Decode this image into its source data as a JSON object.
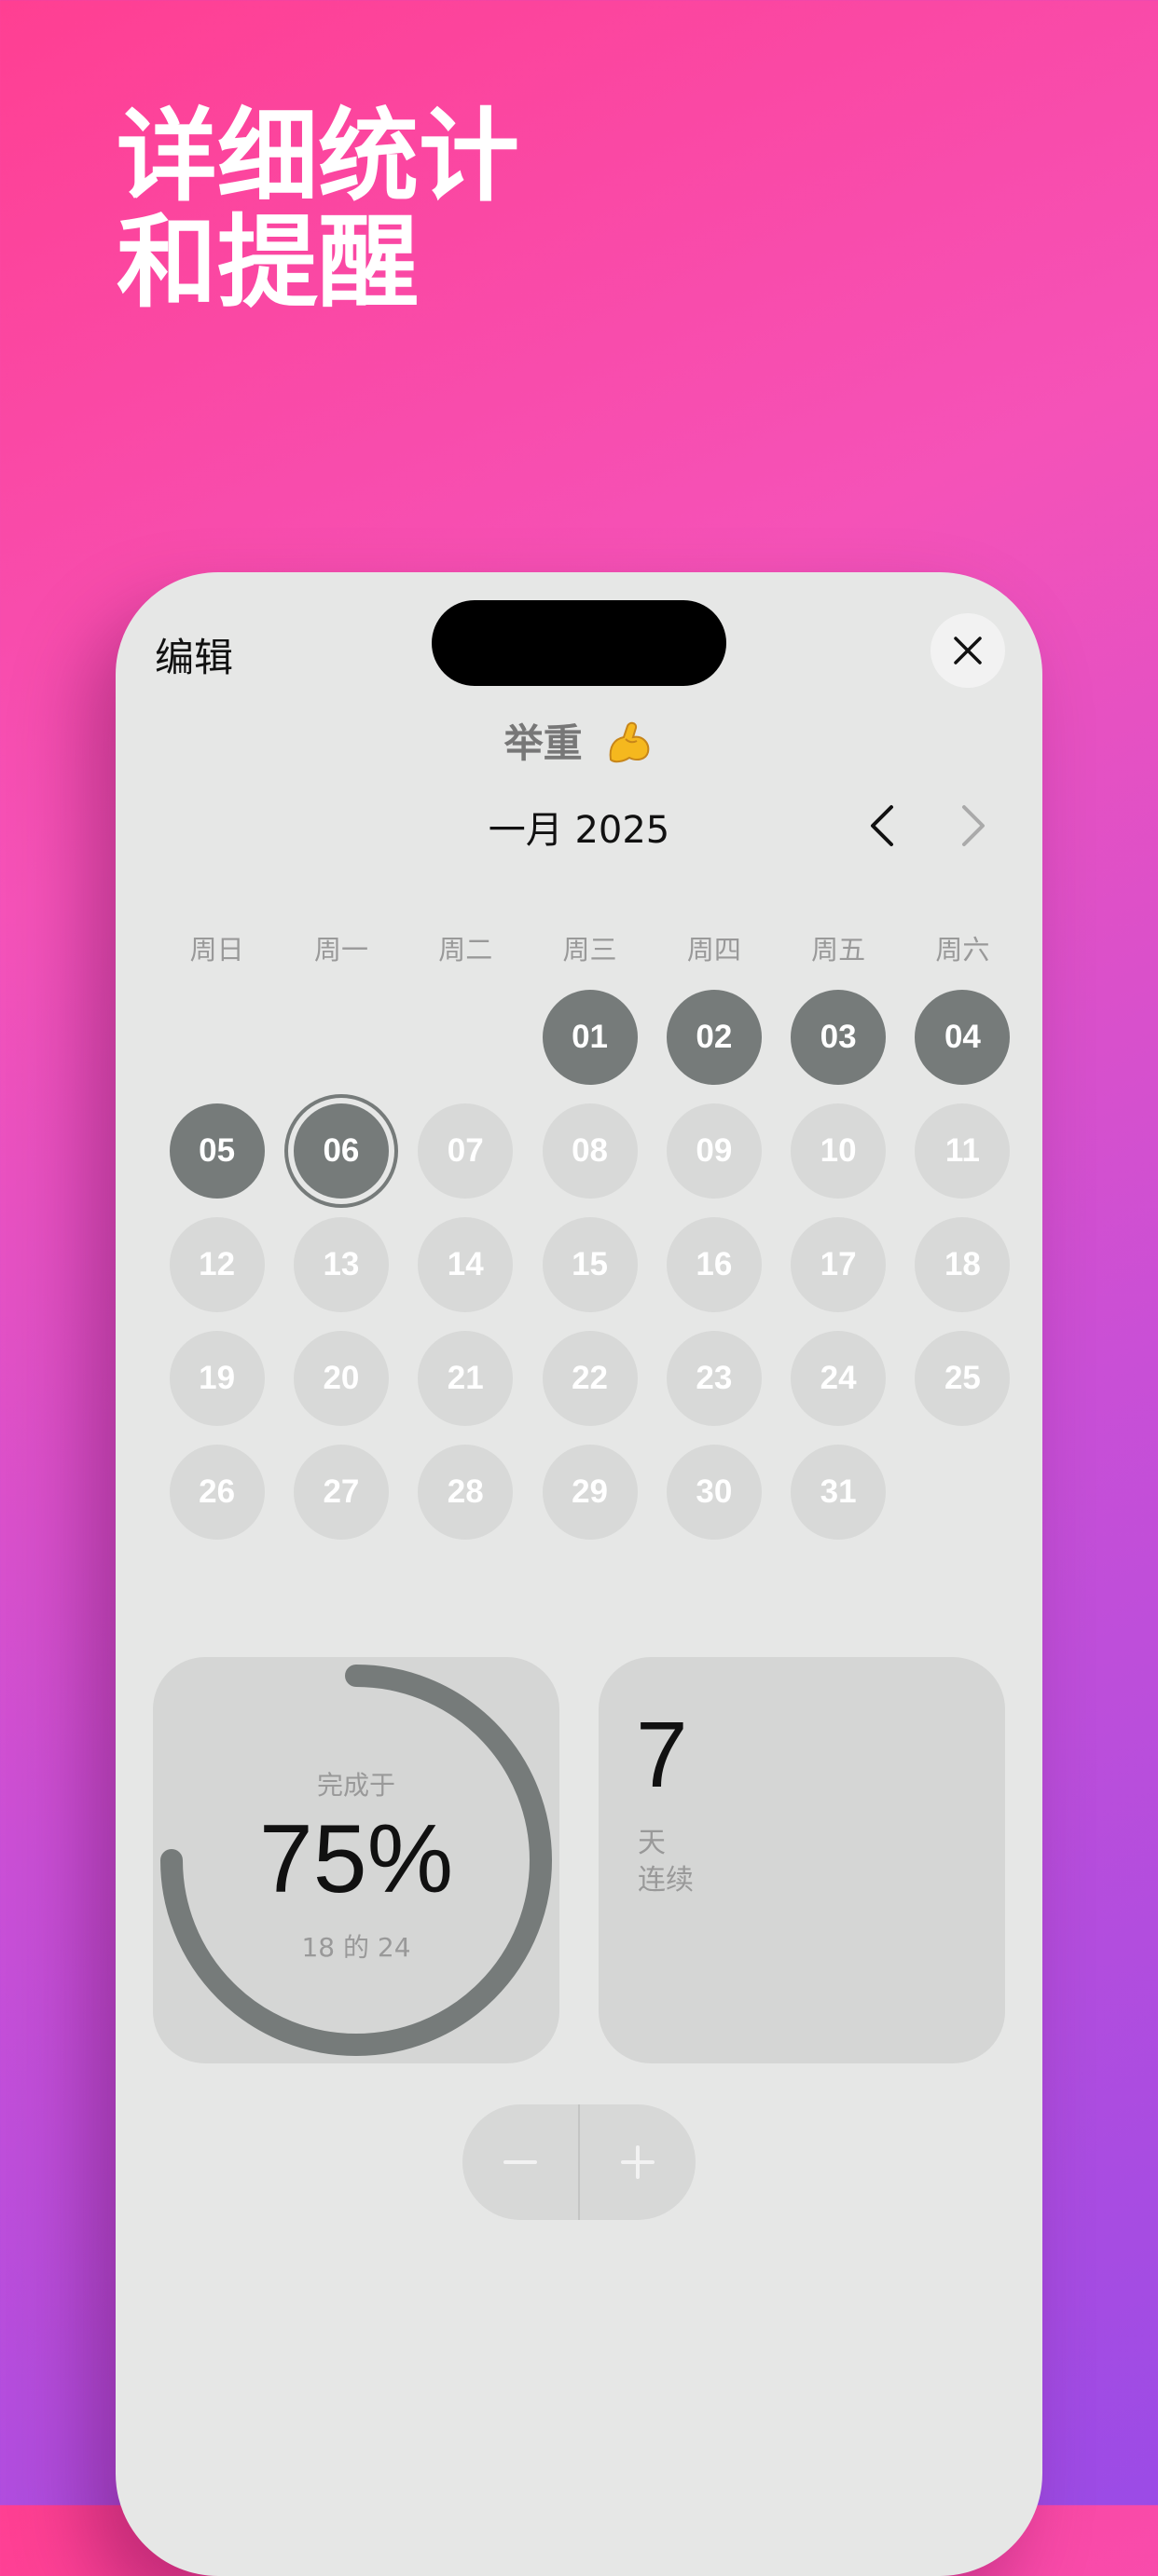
{
  "headline": {
    "line1": "详细统计",
    "line2": "和提醒"
  },
  "header": {
    "edit_label": "编辑",
    "close_icon": "close-icon"
  },
  "habit": {
    "title": "举重",
    "emoji": "💪"
  },
  "calendar": {
    "month_label": "一月 2025",
    "weekdays": [
      "周日",
      "周一",
      "周二",
      "周三",
      "周四",
      "周五",
      "周六"
    ],
    "days": [
      {
        "label": "",
        "state": "empty"
      },
      {
        "label": "",
        "state": "empty"
      },
      {
        "label": "",
        "state": "empty"
      },
      {
        "label": "01",
        "state": "done"
      },
      {
        "label": "02",
        "state": "done"
      },
      {
        "label": "03",
        "state": "done"
      },
      {
        "label": "04",
        "state": "done"
      },
      {
        "label": "05",
        "state": "done"
      },
      {
        "label": "06",
        "state": "today"
      },
      {
        "label": "07",
        "state": "future"
      },
      {
        "label": "08",
        "state": "future"
      },
      {
        "label": "09",
        "state": "future"
      },
      {
        "label": "10",
        "state": "future"
      },
      {
        "label": "11",
        "state": "future"
      },
      {
        "label": "12",
        "state": "future"
      },
      {
        "label": "13",
        "state": "future"
      },
      {
        "label": "14",
        "state": "future"
      },
      {
        "label": "15",
        "state": "future"
      },
      {
        "label": "16",
        "state": "future"
      },
      {
        "label": "17",
        "state": "future"
      },
      {
        "label": "18",
        "state": "future"
      },
      {
        "label": "19",
        "state": "future"
      },
      {
        "label": "20",
        "state": "future"
      },
      {
        "label": "21",
        "state": "future"
      },
      {
        "label": "22",
        "state": "future"
      },
      {
        "label": "23",
        "state": "future"
      },
      {
        "label": "24",
        "state": "future"
      },
      {
        "label": "25",
        "state": "future"
      },
      {
        "label": "26",
        "state": "future"
      },
      {
        "label": "27",
        "state": "future"
      },
      {
        "label": "28",
        "state": "future"
      },
      {
        "label": "29",
        "state": "future"
      },
      {
        "label": "30",
        "state": "future"
      },
      {
        "label": "31",
        "state": "future"
      }
    ]
  },
  "progress": {
    "caption": "完成于",
    "value_text": "75%",
    "fraction": 0.75,
    "sub": "18 的 24"
  },
  "streak": {
    "count": "7",
    "unit": "天",
    "label": "连续"
  },
  "colors": {
    "accent": "#767b7a",
    "inactive_day": "#d8d9d8",
    "card": "#d5d6d5"
  }
}
